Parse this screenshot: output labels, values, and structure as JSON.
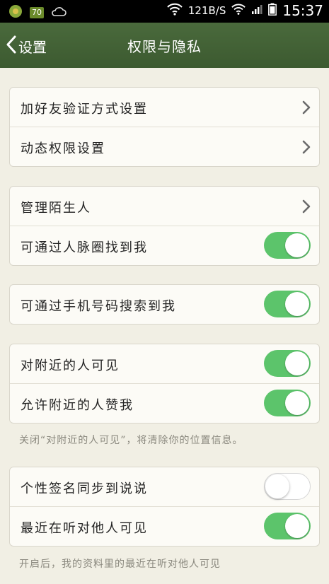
{
  "status_bar": {
    "speed": "121B/S",
    "time": "15:37",
    "icons": [
      "app-icon",
      "badge-70-icon",
      "cloud-icon",
      "wifi-icon",
      "wifi-signal-icon",
      "cell-signal-icon",
      "battery-icon"
    ],
    "badge_text": "70"
  },
  "nav": {
    "back_label": "设置",
    "title": "权限与隐私"
  },
  "groups": [
    {
      "rows": [
        {
          "label": "加好友验证方式设置",
          "control": "chevron"
        },
        {
          "label": "动态权限设置",
          "control": "chevron"
        }
      ]
    },
    {
      "rows": [
        {
          "label": "管理陌生人",
          "control": "chevron"
        },
        {
          "label": "可通过人脉圈找到我",
          "control": "toggle",
          "on": true
        }
      ]
    },
    {
      "rows": [
        {
          "label": "可通过手机号码搜索到我",
          "control": "toggle",
          "on": true
        }
      ]
    },
    {
      "rows": [
        {
          "label": "对附近的人可见",
          "control": "toggle",
          "on": true
        },
        {
          "label": "允许附近的人赞我",
          "control": "toggle",
          "on": true
        }
      ]
    },
    {
      "rows": [
        {
          "label": "个性签名同步到说说",
          "control": "toggle",
          "on": false
        },
        {
          "label": "最近在听对他人可见",
          "control": "toggle",
          "on": true
        }
      ]
    }
  ],
  "notes": {
    "nearby": "关闭“对附近的人可见”，将清除你的位置信息。",
    "listening": "开启后，我的资料里的最近在听对他人可见"
  },
  "colors": {
    "nav_bg": "#445f36",
    "toggle_on": "#5cc46b",
    "page_bg": "#f1efe4"
  }
}
